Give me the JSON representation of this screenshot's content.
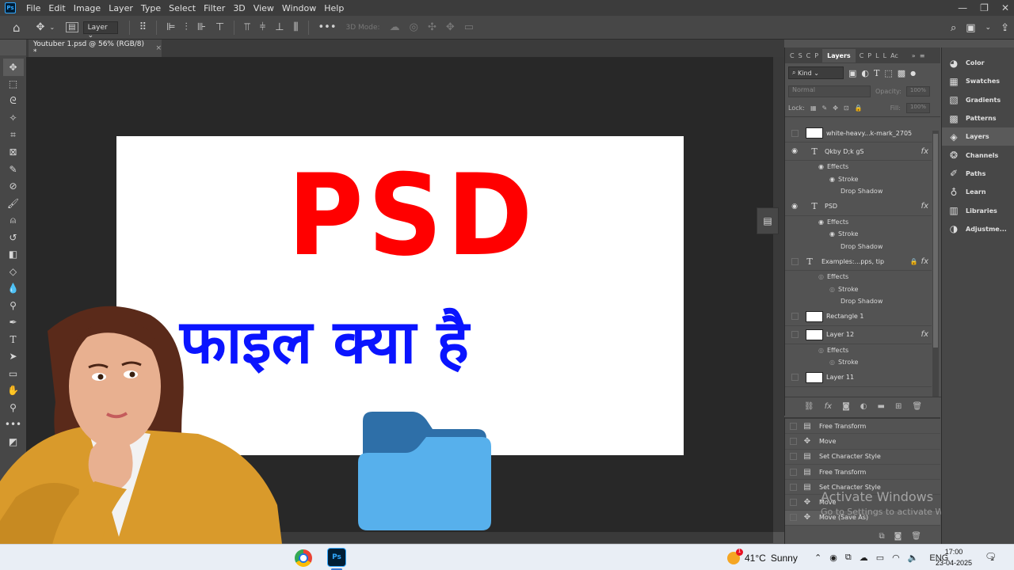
{
  "menubar": {
    "app_icon": "Ps",
    "items": [
      "File",
      "Edit",
      "Image",
      "Layer",
      "Type",
      "Select",
      "Filter",
      "3D",
      "View",
      "Window",
      "Help"
    ],
    "window_controls": [
      "—",
      "❐",
      "✕"
    ]
  },
  "options_bar": {
    "layer_select": "Layer",
    "mode_3d_label": "3D Mode:"
  },
  "doc_tab": {
    "title": "Youtuber 1.psd @ 56% (RGB/8) *",
    "close": "×"
  },
  "artboard": {
    "headline": "PSD",
    "subline": "फाइल क्या है",
    "headline_color": "#ff0000",
    "subline_color": "#0a14ff"
  },
  "layers_panel": {
    "tabs_left": [
      "C",
      "S",
      "C",
      "P"
    ],
    "active_tab": "Layers",
    "tabs_right": [
      "C",
      "P",
      "L",
      "L",
      "Ac"
    ],
    "kind_filter": "Kind",
    "blend_mode": "Normal",
    "opacity_label": "Opacity:",
    "opacity_value": "100%",
    "lock_label": "Lock:",
    "fill_label": "Fill:",
    "fill_value": "100%",
    "layers": [
      {
        "name": "white-heavy...k-mark_2705",
        "type": "image",
        "visible": false
      },
      {
        "name": "Qkby D;k gS",
        "type": "text",
        "visible": true,
        "fx": "fx",
        "effects_label": "Effects",
        "effects": [
          "Stroke",
          "Drop Shadow"
        ]
      },
      {
        "name": "PSD",
        "type": "text",
        "visible": true,
        "fx": "fx",
        "effects_label": "Effects",
        "effects": [
          "Stroke",
          "Drop Shadow"
        ]
      },
      {
        "name": "Examples:...pps, tip",
        "type": "text",
        "visible": false,
        "locked": true,
        "fx": "fx",
        "effects_label": "Effects",
        "effects": [
          "Stroke",
          "Drop Shadow"
        ]
      },
      {
        "name": "Rectangle 1",
        "type": "shape",
        "visible": false
      },
      {
        "name": "Layer 12",
        "type": "image",
        "visible": false,
        "fx": "fx",
        "effects_label": "Effects",
        "effects": [
          "Stroke"
        ]
      },
      {
        "name": "Layer 11",
        "type": "image",
        "visible": false
      }
    ]
  },
  "history_panel": {
    "items": [
      {
        "label": "Free Transform",
        "icon": "doc-icon"
      },
      {
        "label": "Move",
        "icon": "move-icon"
      },
      {
        "label": "Set Character Style",
        "icon": "doc-icon"
      },
      {
        "label": "Free Transform",
        "icon": "doc-icon"
      },
      {
        "label": "Set Character Style",
        "icon": "doc-icon"
      },
      {
        "label": "Move",
        "icon": "move-icon"
      },
      {
        "label": "Move (Save As)",
        "icon": "move-icon"
      }
    ]
  },
  "watermark": {
    "line1": "Activate Windows",
    "line2": "Go to Settings to activate Windows."
  },
  "right_dock": {
    "items": [
      {
        "label": "Color",
        "icon": "color-icon"
      },
      {
        "label": "Swatches",
        "icon": "swatches-icon"
      },
      {
        "label": "Gradients",
        "icon": "gradients-icon"
      },
      {
        "label": "Patterns",
        "icon": "patterns-icon"
      },
      {
        "label": "Layers",
        "icon": "layers-icon",
        "active": true
      },
      {
        "label": "Channels",
        "icon": "channels-icon"
      },
      {
        "label": "Paths",
        "icon": "paths-icon"
      },
      {
        "label": "Learn",
        "icon": "learn-icon"
      },
      {
        "label": "Libraries",
        "icon": "libraries-icon"
      },
      {
        "label": "Adjustme...",
        "icon": "adjustments-icon"
      }
    ]
  },
  "taskbar": {
    "ps_label": "Ps",
    "weather_badge": "1",
    "temperature": "41°C",
    "condition": "Sunny",
    "language": "ENG",
    "time": "17:00",
    "date": "23-04-2025",
    "notification_count": "2"
  }
}
